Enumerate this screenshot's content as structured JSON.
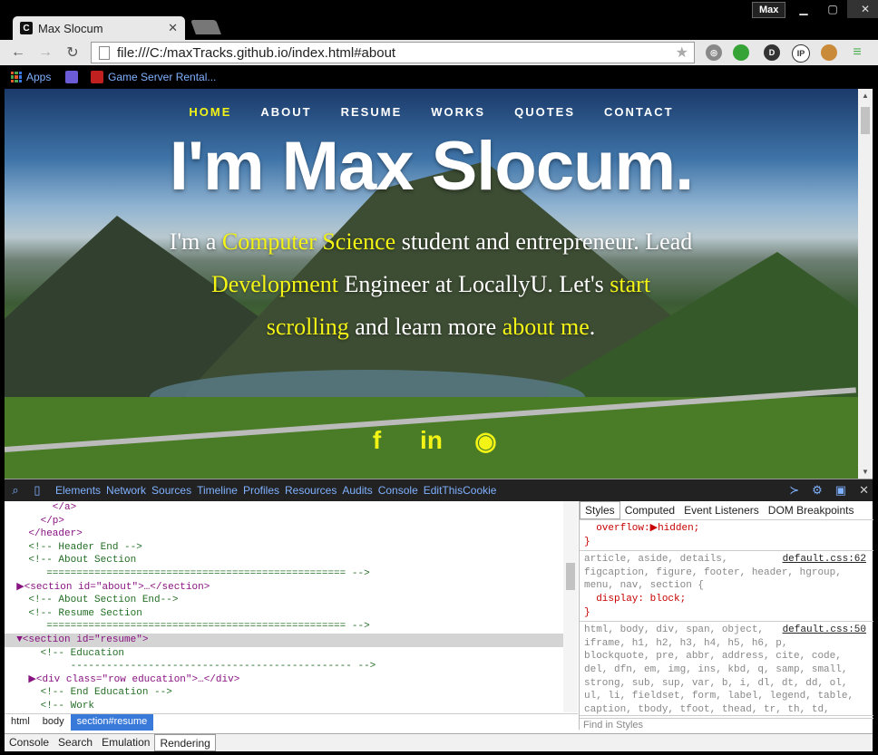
{
  "browser": {
    "tab_title": "Max Slocum",
    "tab_favicon": "C",
    "profile_name": "Max",
    "url": "file:///C:/maxTracks.github.io/index.html#about",
    "bookmarks": [
      "Apps",
      "Game Server Rental..."
    ]
  },
  "site": {
    "nav": [
      "HOME",
      "ABOUT",
      "RESUME",
      "WORKS",
      "QUOTES",
      "CONTACT"
    ],
    "title": "I'm Max Slocum.",
    "intro": {
      "p1": "I'm a ",
      "h1": "Computer Science",
      "p2": " student and entrepreneur. Lead ",
      "h2": "Development",
      "p3": " Engineer at LocallyU. Let's ",
      "h3": "start scrolling",
      "p4": " and learn more ",
      "h4": "about me",
      "p5": "."
    },
    "social": [
      "f",
      "in",
      "github"
    ]
  },
  "devtools": {
    "tabs": [
      "Elements",
      "Network",
      "Sources",
      "Timeline",
      "Profiles",
      "Resources",
      "Audits",
      "Console",
      "EditThisCookie"
    ],
    "elements": [
      "        </a>",
      "      </p>",
      "    </header>",
      "    <!-- Header End -->",
      "    <!-- About Section",
      "       ================================================== -->",
      "  ▶<section id=\"about\">…</section>",
      "    <!-- About Section End-->",
      "    <!-- Resume Section",
      "       ================================================== -->",
      "  ▼<section id=\"resume\">",
      "      <!-- Education",
      "           ----------------------------------------------- -->",
      "    ▶<div class=\"row education\">…</div>",
      "      <!-- End Education -->",
      "      <!-- Work"
    ],
    "breadcrumbs": [
      "html",
      "body",
      "section#resume"
    ],
    "styles_tabs": [
      "Styles",
      "Computed",
      "Event Listeners",
      "DOM Breakpoints"
    ],
    "rule1": "  overflow:▶hidden;\n}",
    "rule2_selector": "article, aside, details,\nfigcaption, figure, footer, header, hgroup,\nmenu, nav, section {",
    "rule2_decl": "  display: block;\n}",
    "rule2_src": "default.css:62",
    "rule3_selector": "html, body, div, span, object,\niframe, h1, h2, h3, h4, h5, h6, p,\nblockquote, pre, abbr, address, cite, code,\ndel, dfn, em, img, ins, kbd, q, samp, small,\nstrong, sub, sup, var, b, i, dl, dt, dd, ol,\nul, li, fieldset, form, label, legend, table,\ncaption, tbody, tfoot, thead, tr, th, td,",
    "rule3_src": "default.css:50",
    "find_placeholder": "Find in Styles",
    "drawer_tabs": [
      "Console",
      "Search",
      "Emulation",
      "Rendering"
    ]
  }
}
